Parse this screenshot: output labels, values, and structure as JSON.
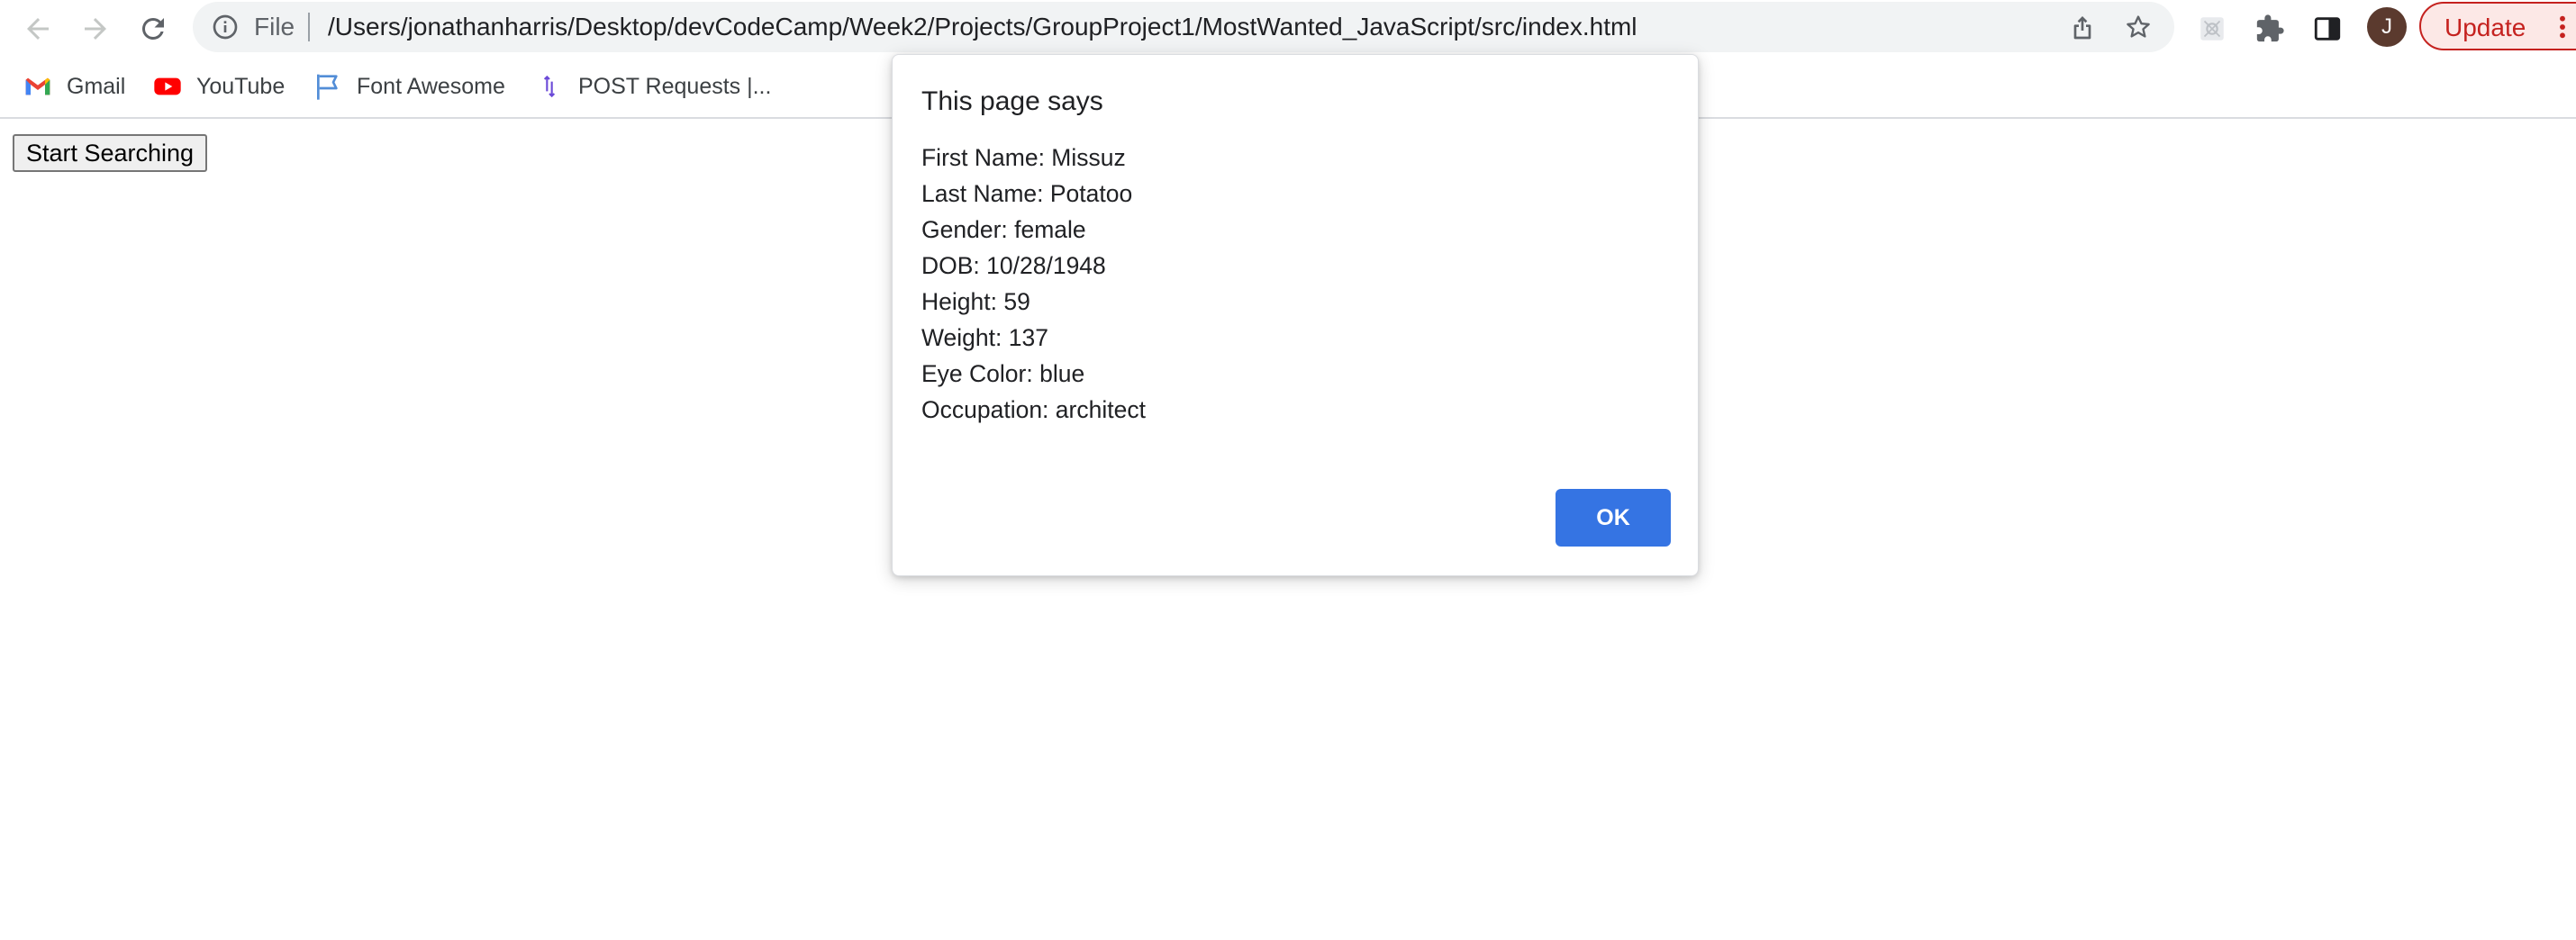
{
  "browser": {
    "address_bar": {
      "scheme_label": "File",
      "url": "/Users/jonathanharris/Desktop/devCodeCamp/Week2/Projects/GroupProject1/MostWanted_JavaScript/src/index.html"
    },
    "profile_initial": "J",
    "update_label": "Update",
    "bookmarks": [
      {
        "label": "Gmail",
        "icon": "gmail-icon"
      },
      {
        "label": "YouTube",
        "icon": "youtube-icon"
      },
      {
        "label": "Font Awesome",
        "icon": "font-awesome-flag-icon"
      },
      {
        "label": "POST Requests |...",
        "icon": "post-requests-icon"
      }
    ]
  },
  "page": {
    "start_button_label": "Start Searching"
  },
  "dialog": {
    "title": "This page says",
    "lines": [
      "First Name: Missuz",
      "Last Name: Potatoo",
      "Gender: female",
      "DOB: 10/28/1948",
      "Height: 59",
      "Weight: 137",
      "Eye Color: blue",
      "Occupation: architect"
    ],
    "ok_label": "OK"
  },
  "colors": {
    "dialog_ok": "#3574e3",
    "update_accent": "#c5221f",
    "avatar_bg": "#5b3a2e"
  }
}
